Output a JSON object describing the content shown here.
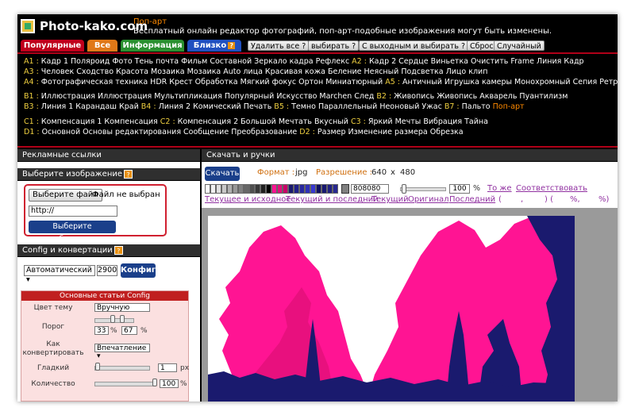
{
  "header": {
    "site_name": "Photo-kako.com",
    "tag": "Поп-арт",
    "description": "Бесплатный онлайн редактор фотографий, поп-арт-подобные изображения могут быть изменены."
  },
  "tabs": {
    "popular": "Популярные",
    "all": "Все",
    "info": "Информация",
    "near": "Близко",
    "badge": "?",
    "buttons": [
      {
        "label": "Удалить все ?"
      },
      {
        "label": "выбирать ?"
      },
      {
        "label": "С выходным и выбирать ?"
      },
      {
        "label": "Сброс"
      },
      {
        "label": "Случайный"
      }
    ]
  },
  "menu": {
    "rows": [
      [
        {
          "t": "A1 :",
          "g": true
        },
        {
          "t": "Кадр 1"
        },
        {
          "t": "Полярoид"
        },
        {
          "t": "Фото"
        },
        {
          "t": "Тень"
        },
        {
          "t": "почта"
        },
        {
          "t": "Фильм"
        },
        {
          "t": "Составной"
        },
        {
          "t": "Зеркало кадра"
        },
        {
          "t": "Рефлекс"
        },
        {
          "t": "A2 :",
          "g": true
        },
        {
          "t": "Кадр 2"
        },
        {
          "t": "Сердце"
        },
        {
          "t": "Виньетка"
        },
        {
          "t": "Очистить Frame"
        },
        {
          "t": "Линия"
        },
        {
          "t": "Кадр"
        }
      ],
      [
        {
          "t": "A3 :",
          "g": true
        },
        {
          "t": "Человек"
        },
        {
          "t": "Сходство"
        },
        {
          "t": "Красота"
        },
        {
          "t": "Мозаика"
        },
        {
          "t": "Мозаика Auto лица"
        },
        {
          "t": "Красивая кожа"
        },
        {
          "t": "Беление"
        },
        {
          "t": "Неясный"
        },
        {
          "t": "Подсветка"
        },
        {
          "t": "Лицо клип"
        }
      ],
      [
        {
          "t": "A4 :",
          "g": true
        },
        {
          "t": "Фотографическая техника"
        },
        {
          "t": "HDR"
        },
        {
          "t": "Крест Обработка"
        },
        {
          "t": "Мягкий фокус"
        },
        {
          "t": "Ортон"
        },
        {
          "t": "Миниатюрный"
        },
        {
          "t": "A5 :",
          "g": true
        },
        {
          "t": "Античный"
        },
        {
          "t": "Игрушка камеры"
        },
        {
          "t": "Монохромный"
        },
        {
          "t": "Сепия"
        },
        {
          "t": "Ретро"
        }
      ],
      [
        {
          "t": "B1 :",
          "g": true
        },
        {
          "t": "Иллюстрация"
        },
        {
          "t": "Иллюстрация"
        },
        {
          "t": "Мультипликация"
        },
        {
          "t": "Популярный"
        },
        {
          "t": "Искусство"
        },
        {
          "t": "Marchen"
        },
        {
          "t": "След"
        },
        {
          "t": "B2 :",
          "g": true
        },
        {
          "t": "Живопись"
        },
        {
          "t": "Живопись"
        },
        {
          "t": "Акварель"
        },
        {
          "t": "Пуантилизм"
        }
      ],
      [
        {
          "t": "B3 :",
          "g": true
        },
        {
          "t": "Линия 1"
        },
        {
          "t": "Карандаш"
        },
        {
          "t": "Край"
        },
        {
          "t": "B4 :",
          "g": true
        },
        {
          "t": "Линия 2"
        },
        {
          "t": "Комический"
        },
        {
          "t": "Печать"
        },
        {
          "t": "B5 :",
          "g": true
        },
        {
          "t": "Темно"
        },
        {
          "t": "Параллельный"
        },
        {
          "t": "Неоновый"
        },
        {
          "t": "Ужас"
        },
        {
          "t": "B7 :",
          "g": true
        },
        {
          "t": "Пальто"
        },
        {
          "t": "Поп-арт",
          "a": true
        }
      ],
      [
        {
          "t": "C1 :",
          "g": true
        },
        {
          "t": "Компенсация 1"
        },
        {
          "t": "Компенсация"
        },
        {
          "t": "C2 :",
          "g": true
        },
        {
          "t": "Компенсация 2"
        },
        {
          "t": "Большой"
        },
        {
          "t": "Мечтать"
        },
        {
          "t": "Вкусный"
        },
        {
          "t": "C3 :",
          "g": true
        },
        {
          "t": "Яркий"
        },
        {
          "t": "Мечты"
        },
        {
          "t": "Вибрация"
        },
        {
          "t": "Тайна"
        }
      ],
      [
        {
          "t": "D1 :",
          "g": true
        },
        {
          "t": "Основной"
        },
        {
          "t": "Основы редактирования"
        },
        {
          "t": "Сообщение"
        },
        {
          "t": "Преобразование"
        },
        {
          "t": "D2 :",
          "g": true
        },
        {
          "t": "Размер"
        },
        {
          "t": "Изменение размера"
        },
        {
          "t": "Обрезка"
        }
      ]
    ]
  },
  "left": {
    "ads_title": "Рекламные ссылки",
    "choose_title": "Выберите изображение",
    "help": "?",
    "file_button": "Выберите файл",
    "file_status": "Файл не выбран",
    "url_value": "http://",
    "choose_button": "Выберите изображение",
    "config_title": "Config и конвертации",
    "select_value": "Автоматический",
    "select_arrow": "▾",
    "size_value": "2900",
    "config_button": "Конфиг",
    "cfg": {
      "title": "Основные статьи Config",
      "color_label": "Цвет тему",
      "color_value": "Вручную",
      "threshold_label": "Порог",
      "threshold_low": "33",
      "threshold_high": "67",
      "percent": "%",
      "convert_label": "Как конвертировать",
      "convert_value": "Впечатление",
      "smooth_label": "Гладкий",
      "smooth_value": "1",
      "smooth_unit": "px",
      "count_label": "Количество",
      "count_value": "100"
    }
  },
  "right": {
    "title": "Скачать и ручки",
    "download_button": "Скачать",
    "format_label": "Формат :",
    "format_value": "jpg",
    "resolution_label": "Разрешение :",
    "width": "640",
    "x": "x",
    "height": "480",
    "palette": [
      "#ffffff",
      "#f0f0f0",
      "#e0e0e0",
      "#c8c8c8",
      "#b0b0b0",
      "#989898",
      "#808080",
      "#686868",
      "#505050",
      "#383838",
      "#202020",
      "#000000",
      "#ff1493",
      "#e0107a",
      "#c8006a",
      "#1a1a6e",
      "#20208a",
      "#2828a0",
      "#3030b8",
      "#3838d0",
      "#101060",
      "#181870",
      "#202080",
      "#282890"
    ],
    "color_hex": "808080",
    "zoom_value": "100",
    "zoom_unit": "%",
    "link_same": "То же",
    "link_match": "Соответствовать",
    "link_current_source": "Текущее и исходное",
    "link_current_last": "Текущий и последний",
    "link_current": "Текущий",
    "link_original": "Оригинал",
    "link_last": "Последний",
    "paren_open": "(",
    "paren_comma": ",",
    "paren_close_open": ") (",
    "paren_pct": "%,",
    "paren_end": "%)"
  },
  "colors": {
    "accent_red": "#c0001c",
    "pink": "#ff1493",
    "navy": "#1a1a6e",
    "button_blue": "#1a3f8a"
  }
}
